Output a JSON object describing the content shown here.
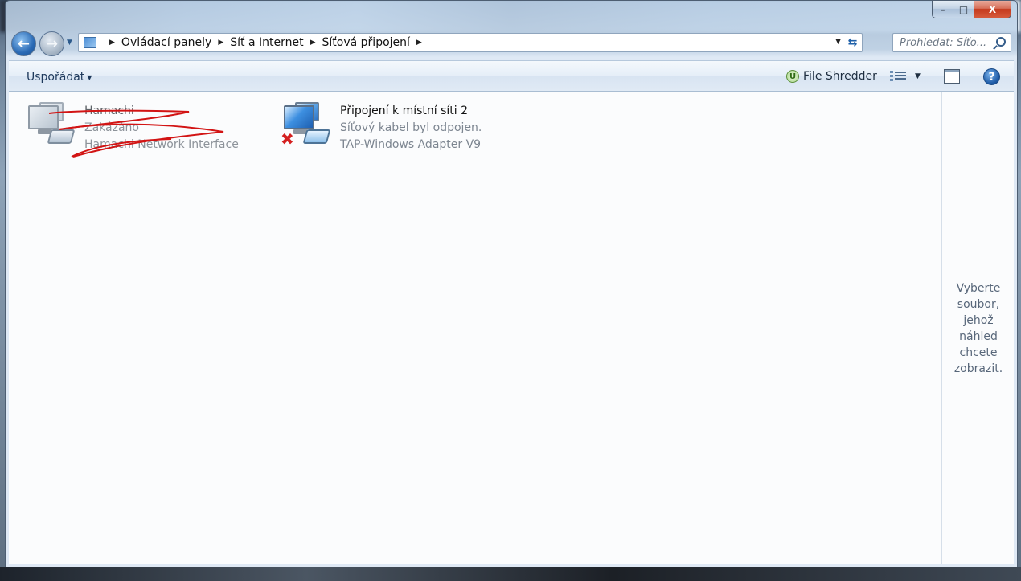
{
  "window": {
    "caption_buttons": {
      "minimize": "–",
      "maximize": "□",
      "close": "X"
    }
  },
  "navigation": {
    "back_icon": "arrow-left-icon",
    "forward_icon": "arrow-right-icon",
    "breadcrumb": [
      "Ovládací panely",
      "Síť a Internet",
      "Síťová připojení"
    ],
    "search_placeholder": "Prohledat: Síťo..."
  },
  "command_bar": {
    "organize_label": "Uspořádat",
    "file_shredder_label": "File Shredder",
    "file_shredder_glyph": "U",
    "help_glyph": "?"
  },
  "connections": [
    {
      "name": "Hamachi",
      "status": "Zakázáno",
      "device": "Hamachi Network Interface",
      "state": "disabled",
      "scribbled_out": true
    },
    {
      "name": "Připojení k místní síti 2",
      "status": "Síťový kabel byl odpojen.",
      "device": "TAP-Windows Adapter V9",
      "state": "disconnected",
      "error_glyph": "✖"
    }
  ],
  "preview_pane": {
    "lines": [
      "Vyberte",
      "soubor,",
      "jehož",
      "náhled",
      "chcete",
      "zobrazit."
    ]
  },
  "colors": {
    "scribble": "#d21414",
    "accent": "#1f5ca8",
    "disconnected_x": "#d42020"
  }
}
